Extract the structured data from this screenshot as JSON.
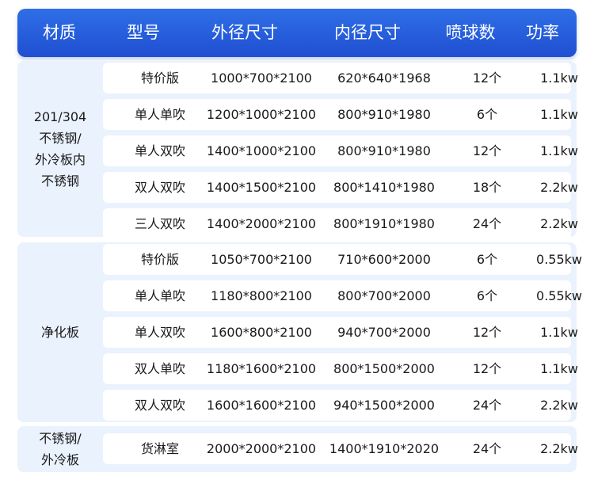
{
  "header": [
    "材质",
    "型号",
    "外径尺寸",
    "内径尺寸",
    "喷球数",
    "功率"
  ],
  "groups": [
    {
      "material": "201/304\n不锈钢/\n外冷板内\n不锈钢",
      "rows": [
        [
          "特价版",
          "1000*700*2100",
          "620*640*1968",
          "12个",
          "1.1kw"
        ],
        [
          "单人单吹",
          "1200*1000*2100",
          "800*910*1980",
          "6个",
          "1.1kw"
        ],
        [
          "单人双吹",
          "1400*1000*2100",
          "800*910*1980",
          "12个",
          "1.1kw"
        ],
        [
          "双人双吹",
          "1400*1500*2100",
          "800*1410*1980",
          "18个",
          "2.2kw"
        ],
        [
          "三人双吹",
          "1400*2000*2100",
          "800*1910*1980",
          "24个",
          "2.2kw"
        ]
      ]
    },
    {
      "material": "净化板",
      "rows": [
        [
          "特价版",
          "1050*700*2100",
          "710*600*2000",
          "6个",
          "0.55kw"
        ],
        [
          "单人单吹",
          "1180*800*2100",
          "800*700*2000",
          "6个",
          "0.55kw"
        ],
        [
          "单人双吹",
          "1600*800*2100",
          "940*700*2000",
          "12个",
          "1.1kw"
        ],
        [
          "双人单吹",
          "1180*1600*2100",
          "800*1500*2000",
          "12个",
          "1.1kw"
        ],
        [
          "双人双吹",
          "1600*1600*2100",
          "940*1500*2000",
          "24个",
          "2.2kw"
        ]
      ]
    },
    {
      "material": "不锈钢/\n外冷板",
      "rows": [
        [
          "货淋室",
          "2000*2000*2100",
          "1400*1910*2020",
          "24个",
          "2.2kw"
        ]
      ]
    }
  ]
}
